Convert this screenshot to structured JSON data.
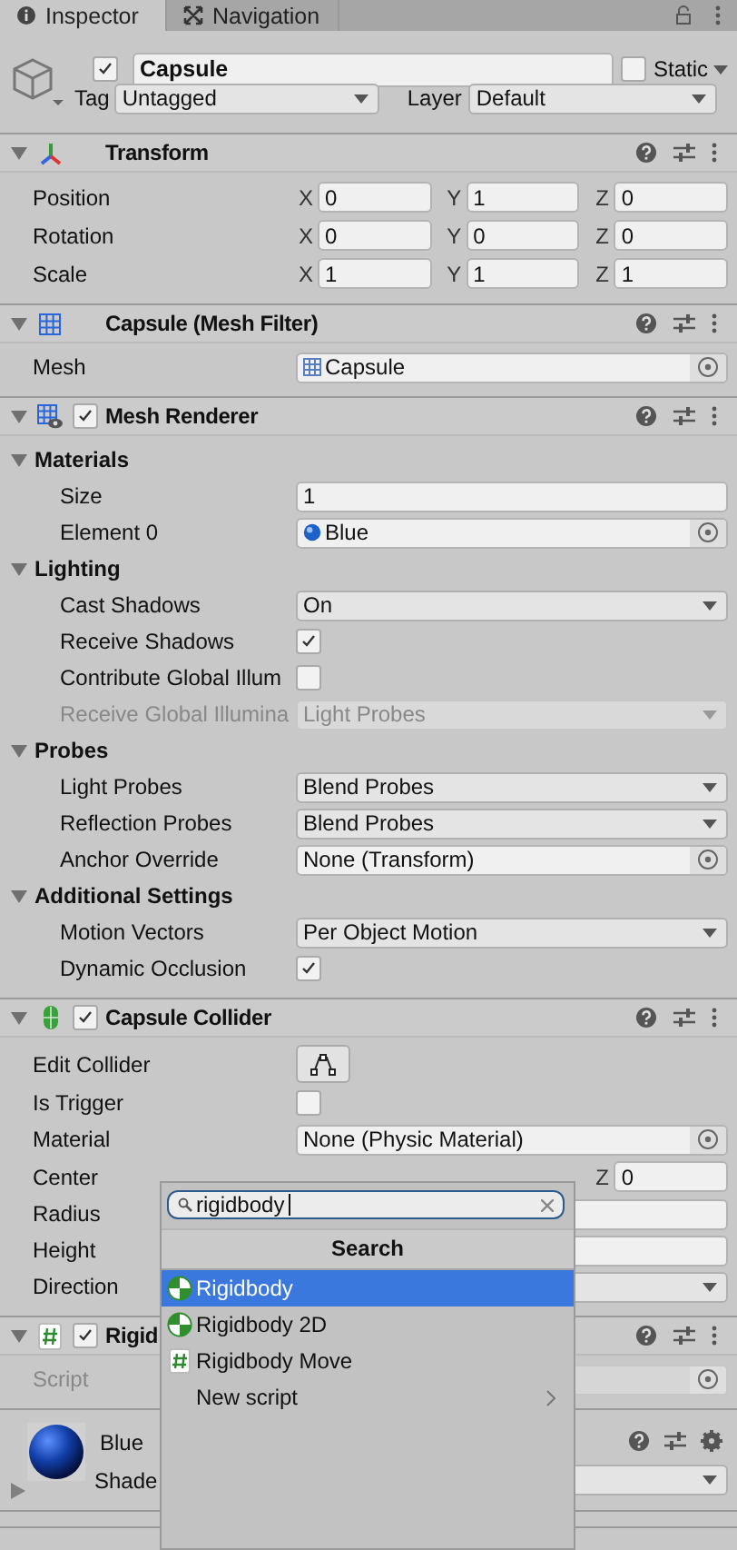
{
  "tabs": [
    {
      "label": "Inspector",
      "kind": "info",
      "selected": true
    },
    {
      "label": "Navigation",
      "kind": "nav",
      "selected": false
    }
  ],
  "object": {
    "active": true,
    "name": "Capsule",
    "static": false,
    "static_label": "Static",
    "tag_label": "Tag",
    "tag": "Untagged",
    "layer_label": "Layer",
    "layer": "Default"
  },
  "components": [
    {
      "title": "Transform",
      "kind": "transform",
      "expanded": true,
      "rows": [
        {
          "kind": "vector",
          "label": "Position",
          "fields": [
            {
              "axis": "X",
              "value": "0"
            },
            {
              "axis": "Y",
              "value": "1"
            },
            {
              "axis": "Z",
              "value": "0"
            }
          ]
        },
        {
          "kind": "vector",
          "label": "Rotation",
          "fields": [
            {
              "axis": "X",
              "value": "0"
            },
            {
              "axis": "Y",
              "value": "0"
            },
            {
              "axis": "Z",
              "value": "0"
            }
          ]
        },
        {
          "kind": "vector",
          "label": "Scale",
          "fields": [
            {
              "axis": "X",
              "value": "1"
            },
            {
              "axis": "Y",
              "value": "1"
            },
            {
              "axis": "Z",
              "value": "1"
            }
          ]
        }
      ]
    },
    {
      "title": "Capsule (Mesh Filter)",
      "kind": "meshfilter",
      "expanded": true,
      "rows": [
        {
          "kind": "mesh-object",
          "label": "Mesh",
          "value": "Capsule"
        }
      ]
    },
    {
      "title": "Mesh Renderer",
      "kind": "meshrenderer",
      "enabled": true,
      "expanded": true,
      "rows": [
        {
          "kind": "section",
          "label": "Materials",
          "expanded": true,
          "children": [
            {
              "kind": "number",
              "label": "Size",
              "value": "1"
            },
            {
              "kind": "material-object",
              "label": "Element 0",
              "value": "Blue"
            }
          ]
        },
        {
          "kind": "section",
          "label": "Lighting",
          "expanded": true,
          "children": [
            {
              "kind": "dropdown",
              "label": "Cast Shadows",
              "value": "On"
            },
            {
              "kind": "check",
              "label": "Receive Shadows",
              "checked": true
            },
            {
              "kind": "check",
              "label": "Contribute Global Illum",
              "checked": false
            },
            {
              "kind": "dropdown",
              "label": "Receive Global Illumina",
              "value": "Light Probes",
              "disabled": true
            }
          ]
        },
        {
          "kind": "section",
          "label": "Probes",
          "expanded": true,
          "children": [
            {
              "kind": "dropdown",
              "label": "Light Probes",
              "value": "Blend Probes"
            },
            {
              "kind": "dropdown",
              "label": "Reflection Probes",
              "value": "Blend Probes"
            },
            {
              "kind": "object",
              "label": "Anchor Override",
              "value": "None (Transform)"
            }
          ]
        },
        {
          "kind": "section",
          "label": "Additional Settings",
          "expanded": true,
          "children": [
            {
              "kind": "dropdown",
              "label": "Motion Vectors",
              "value": "Per Object Motion"
            },
            {
              "kind": "check",
              "label": "Dynamic Occlusion",
              "checked": true
            }
          ]
        }
      ]
    },
    {
      "title": "Capsule Collider",
      "kind": "collider",
      "enabled": true,
      "expanded": true,
      "rows": [
        {
          "kind": "button",
          "label": "Edit Collider"
        },
        {
          "kind": "check",
          "label": "Is Trigger",
          "checked": false
        },
        {
          "kind": "object",
          "label": "Material",
          "value": "None (Physic Material)"
        },
        {
          "kind": "vector",
          "label": "Center",
          "fields": [
            {
              "axis": "Z",
              "value": "0"
            }
          ]
        },
        {
          "kind": "number",
          "label": "Radius"
        },
        {
          "kind": "number",
          "label": "Height"
        },
        {
          "kind": "dropdown",
          "label": "Direction"
        }
      ]
    },
    {
      "title": "Rigid",
      "kind": "script",
      "enabled": true,
      "expanded": true,
      "rows": [
        {
          "kind": "object",
          "label": "Script",
          "disabled": true
        }
      ]
    }
  ],
  "material": {
    "name": "Blue",
    "shader_label": "Shade",
    "expanded": false
  },
  "popup": {
    "query": "rigidbody",
    "header": "Search",
    "items": [
      {
        "label": "Rigidbody",
        "kind": "physics",
        "selected": true
      },
      {
        "label": "Rigidbody 2D",
        "kind": "physics",
        "selected": false
      },
      {
        "label": "Rigidbody Move",
        "kind": "script",
        "selected": false
      },
      {
        "label": "New script",
        "kind": "menu",
        "submenu": true,
        "selected": false
      }
    ]
  }
}
